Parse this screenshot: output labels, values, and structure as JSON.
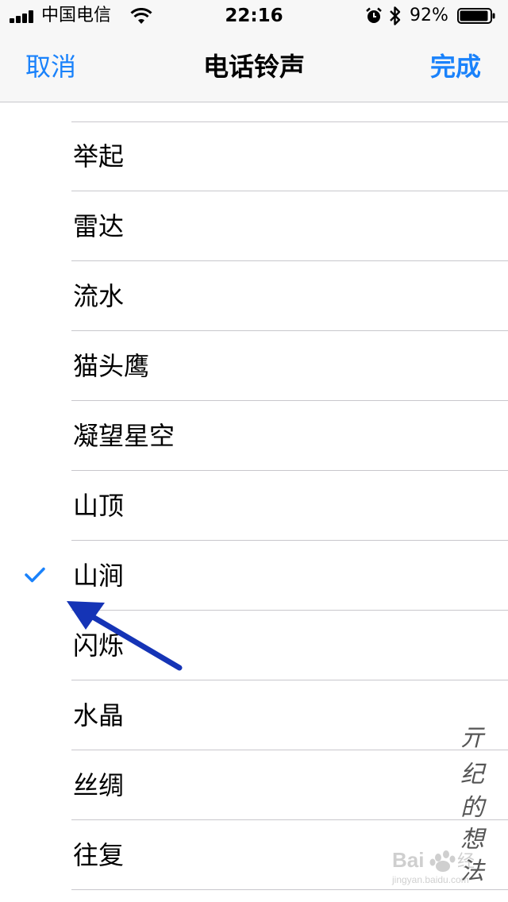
{
  "status_bar": {
    "carrier": "中国电信",
    "time": "22:16",
    "battery_percent": "92%",
    "signal_bars": 4,
    "icons": [
      "signal-icon",
      "wifi-icon",
      "alarm-icon",
      "bluetooth-icon",
      "battery-icon"
    ]
  },
  "nav": {
    "cancel_label": "取消",
    "title": "电话铃声",
    "done_label": "完成"
  },
  "ringtones": [
    {
      "label": "举起",
      "selected": false
    },
    {
      "label": "雷达",
      "selected": false
    },
    {
      "label": "流水",
      "selected": false
    },
    {
      "label": "猫头鹰",
      "selected": false
    },
    {
      "label": "凝望星空",
      "selected": false
    },
    {
      "label": "山顶",
      "selected": false
    },
    {
      "label": "山涧",
      "selected": true
    },
    {
      "label": "闪烁",
      "selected": false
    },
    {
      "label": "水晶",
      "selected": false
    },
    {
      "label": "丝绸",
      "selected": false
    },
    {
      "label": "往复",
      "selected": false
    }
  ],
  "colors": {
    "accent": "#1a82fb",
    "annotation_arrow": "#1534b6",
    "separator": "#c8c7cc",
    "bar_background": "#f7f7f7"
  },
  "watermark": {
    "signature": "亓纪的想法",
    "logo": "Baidu经验",
    "logo_url": "jingyan.baidu.com"
  }
}
